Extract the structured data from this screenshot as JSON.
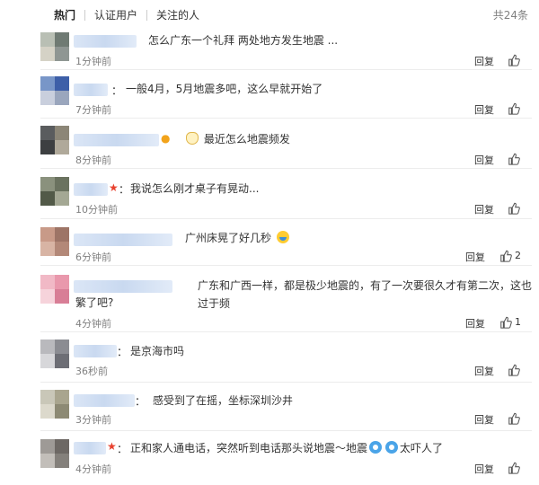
{
  "tabs": [
    {
      "label": "热门",
      "active": true
    },
    {
      "label": "认证用户",
      "active": false
    },
    {
      "label": "关注的人",
      "active": false
    }
  ],
  "total_label": "共24条",
  "reply_label": "回复",
  "colors": {
    "username": "#c9d9f0",
    "badge_red": "#e8422f",
    "badge_gold": "#f2a31b",
    "muted": "#808080"
  },
  "comments": [
    {
      "text": "怎么广东一个礼拜 两处地方发生地震 ...",
      "time": "1分钟前",
      "likes": ""
    },
    {
      "text": "一般4月，5月地震多吧，这么早就开始了",
      "time": "7分钟前",
      "likes": ""
    },
    {
      "text": "最近怎么地震频发",
      "time": "8分钟前",
      "likes": ""
    },
    {
      "text": "我说怎么刚才桌子有晃动...",
      "time": "10分钟前",
      "likes": ""
    },
    {
      "text": "广州床晃了好几秒",
      "time": "6分钟前",
      "likes": "2"
    },
    {
      "text": "广东和广西一样，都是极少地震的，有了一次要很久才有第二次，这也过于频",
      "text2": "繁了吧?",
      "time": "4分钟前",
      "likes": "1"
    },
    {
      "text": "是京海市吗",
      "time": "36秒前",
      "likes": ""
    },
    {
      "text": "感受到了在摇，坐标深圳沙井",
      "time": "3分钟前",
      "likes": ""
    },
    {
      "text": "正和家人通电话，突然听到电话那头说地震～地震",
      "text_end": "太吓人了",
      "time": "4分钟前",
      "likes": ""
    }
  ]
}
